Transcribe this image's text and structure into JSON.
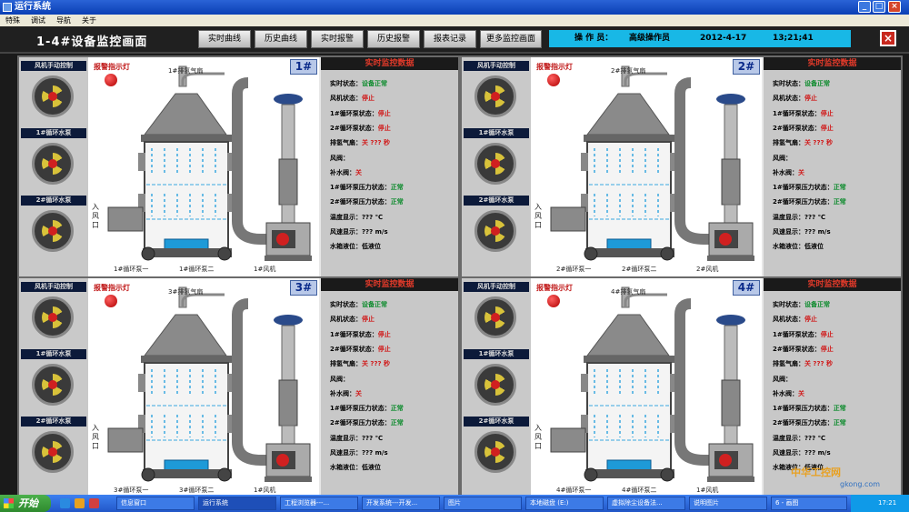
{
  "window": {
    "title": "运行系统",
    "min": "_",
    "max": "□",
    "close": "×"
  },
  "menu": [
    "特殊",
    "调试",
    "导航",
    "关于"
  ],
  "header": {
    "title": "1-4#设备监控画面",
    "nav": [
      "实时曲线",
      "历史曲线",
      "实时报警",
      "历史报警",
      "报表记录",
      "更多监控画面"
    ],
    "operator_label": "操 作 员：",
    "operator_name": "高级操作员",
    "date": "2012-4-17",
    "time": "13;21;41",
    "exit_glyph": "×"
  },
  "panels": [
    {
      "num": "1#",
      "fan_label": "1#排氢气扇",
      "bottom": [
        "1#循环泵一",
        "1#循环泵二",
        "1#风机"
      ]
    },
    {
      "num": "2#",
      "fan_label": "2#排氢气扇",
      "bottom": [
        "2#循环泵一",
        "2#循环泵二",
        "2#风机"
      ]
    },
    {
      "num": "3#",
      "fan_label": "3#排氢气扇",
      "bottom": [
        "3#循环泵一",
        "3#循环泵二",
        "1#风机"
      ]
    },
    {
      "num": "4#",
      "fan_label": "4#排氢气扇",
      "bottom": [
        "4#循环泵一",
        "4#循环泵二",
        "1#风机"
      ]
    }
  ],
  "ctrl": {
    "fan_ctrl": "风机手动控制",
    "pump1": "1#循环水泵",
    "pump2": "2#循环水泵"
  },
  "alarm_label": "报警指示灯",
  "inlet": "入风口",
  "data": {
    "head": "实时监控数据",
    "rows": [
      {
        "k": "实时状态：",
        "v": "设备正常",
        "c": "ok"
      },
      {
        "k": "风机状态：",
        "v": "停止",
        "c": "bad"
      },
      {
        "k": "1#循环泵状态：",
        "v": "停止",
        "c": "bad"
      },
      {
        "k": "2#循环泵状态：",
        "v": "停止",
        "c": "bad"
      },
      {
        "k": "排氢气扇：",
        "v": "关    ???  秒",
        "c": "bad"
      },
      {
        "k": "风阀：",
        "v": "",
        "c": ""
      },
      {
        "k": "补水阀：",
        "v": "关",
        "c": "bad"
      },
      {
        "k": "1#循环泵压力状态：",
        "v": "正常",
        "c": "ok"
      },
      {
        "k": "2#循环泵压力状态：",
        "v": "正常",
        "c": "ok"
      },
      {
        "k": "温度显示：",
        "v": "???  ℃",
        "c": ""
      },
      {
        "k": "风速显示：",
        "v": "???   m/s",
        "c": ""
      },
      {
        "k": "水箱液位：",
        "v": "低液位",
        "c": ""
      }
    ]
  },
  "taskbar": {
    "start": "开始",
    "tasks": [
      "信息窗口",
      "运行系统",
      "工程浏览器---...",
      "开发系统---开发...",
      "图片",
      "本地磁盘 (E:)",
      "虚拟除尘设备法...",
      "说明图片",
      "6 - 画图"
    ],
    "clock": "17:21"
  },
  "watermark": "中华工控网",
  "watermark2": "gkong.com"
}
